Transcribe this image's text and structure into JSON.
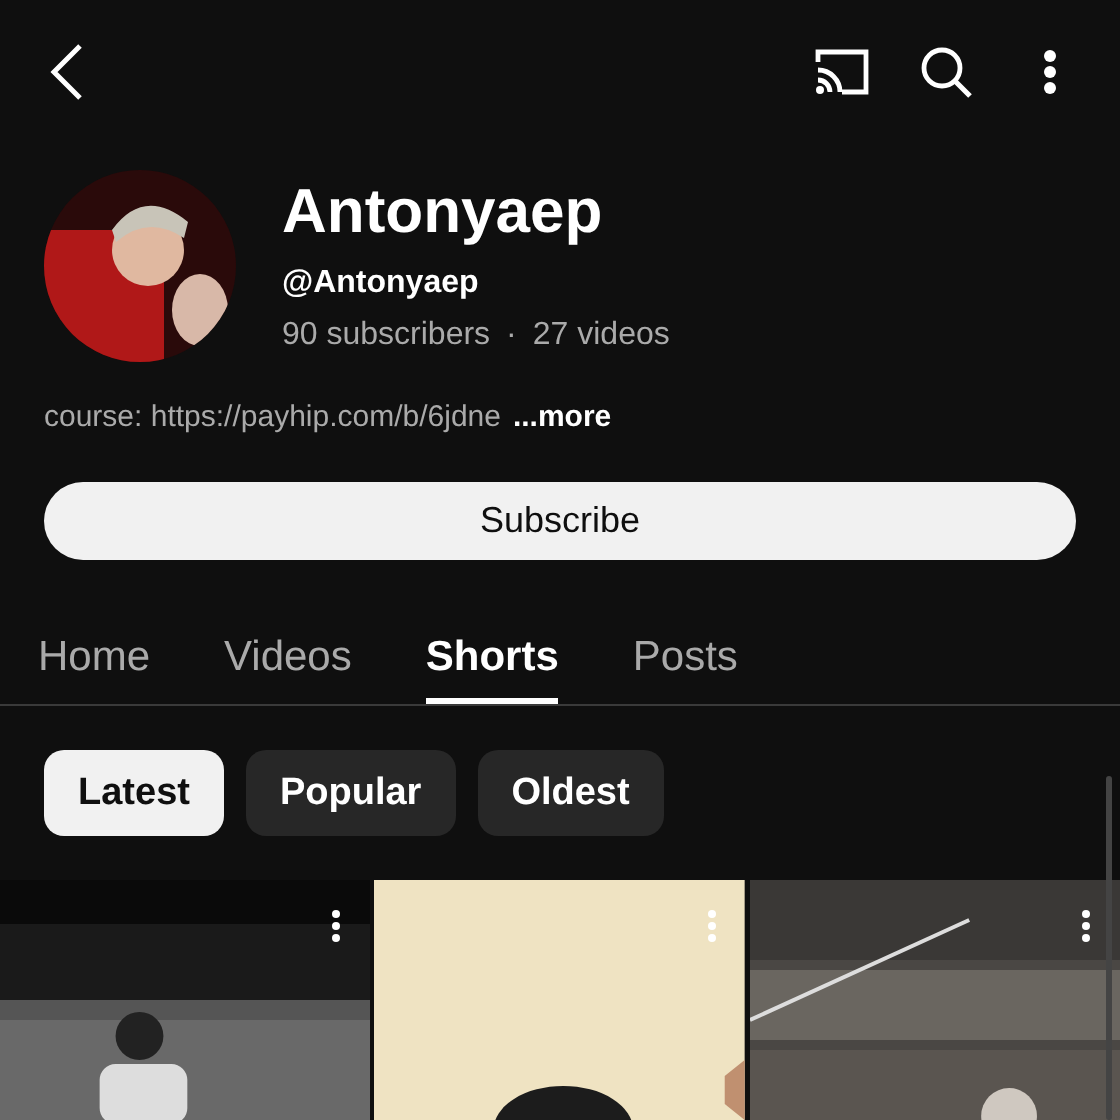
{
  "channel": {
    "name": "Antonyaep",
    "handle": "@Antonyaep",
    "subscribers": "90 subscribers",
    "separator": "·",
    "videos": "27 videos",
    "description": "course: https://payhip.com/b/6jdne",
    "more": "...more"
  },
  "subscribe_button": "Subscribe",
  "tabs": [
    {
      "label": "Home",
      "selected": false
    },
    {
      "label": "Videos",
      "selected": false
    },
    {
      "label": "Shorts",
      "selected": true
    },
    {
      "label": "Posts",
      "selected": false
    }
  ],
  "filters": [
    {
      "label": "Latest",
      "selected": true
    },
    {
      "label": "Popular",
      "selected": false
    },
    {
      "label": "Oldest",
      "selected": false
    }
  ]
}
